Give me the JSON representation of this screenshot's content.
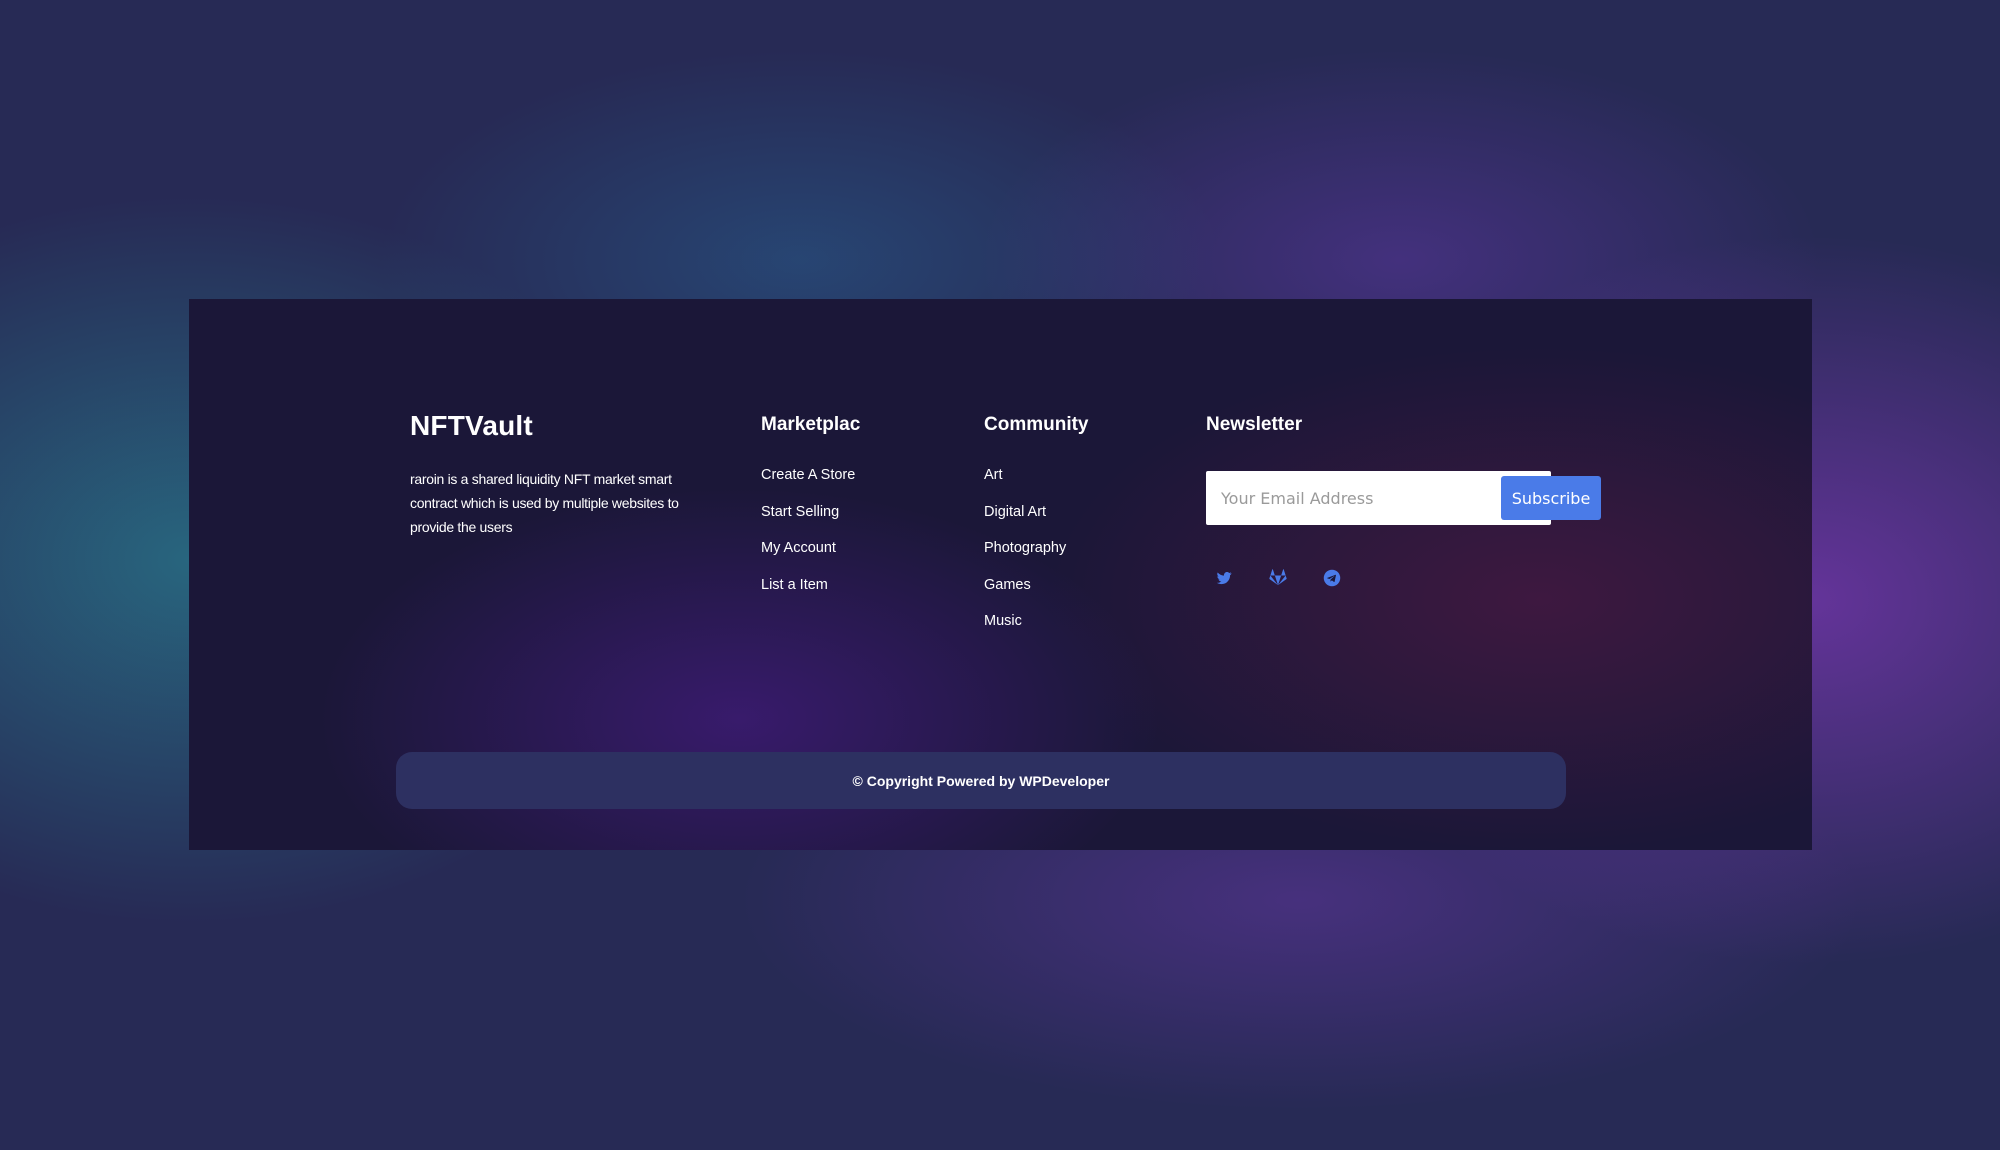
{
  "brand": {
    "name": "NFTVault",
    "description": "raroin is a shared liquidity NFT market smart contract which is used by multiple websites to provide the users"
  },
  "marketplace": {
    "title": "Marketplac",
    "links": [
      "Create A Store",
      "Start Selling",
      "My Account",
      "List a Item"
    ]
  },
  "community": {
    "title": "Community",
    "links": [
      "Art",
      "Digital Art",
      "Photography",
      "Games",
      "Music"
    ]
  },
  "newsletter": {
    "title": "Newsletter",
    "email_placeholder": "Your Email Address",
    "subscribe_label": "Subscribe"
  },
  "socials": [
    {
      "icon": "twitter-icon"
    },
    {
      "icon": "gitlab-icon"
    },
    {
      "icon": "telegram-icon"
    }
  ],
  "copyright": "© Copyright Powered by WPDeveloper",
  "colors": {
    "accent": "#4a7be8",
    "footer_bg": "#1b1738",
    "copyright_bg": "#2d3061",
    "page_bg": "#272a55"
  }
}
